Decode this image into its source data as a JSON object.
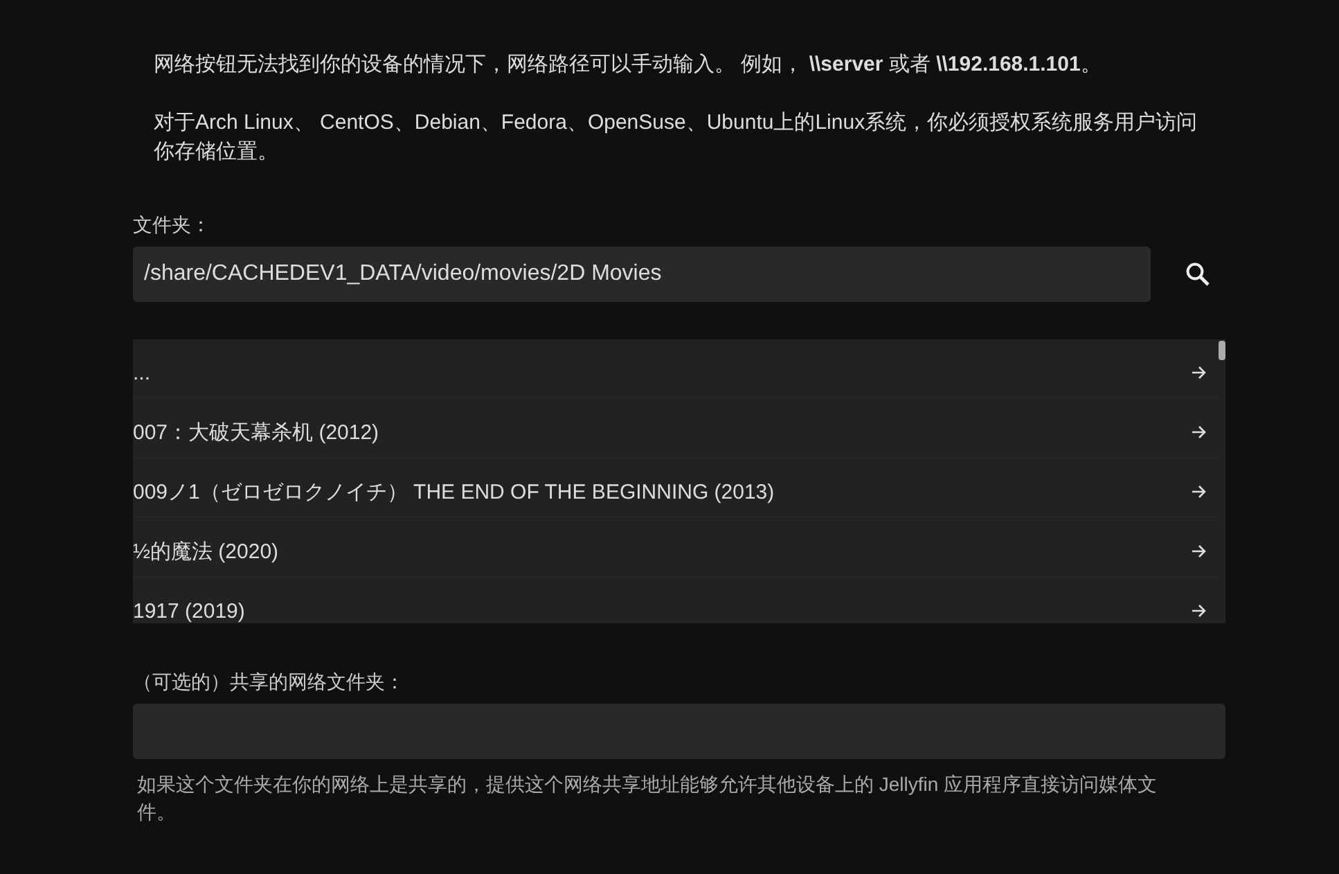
{
  "intro": [
    "网络按钮无法找到你的设备的情况下，网络路径可以手动输入。 例如， **\\\\server** 或者 **\\\\192.168.1.101**。",
    "对于Arch Linux、 CentOS、Debian、Fedora、OpenSuse、Ubuntu上的Linux系统，你必须授权系统服务用户访问你存储位置。"
  ],
  "folder": {
    "label": "文件夹：",
    "value": "/share/CACHEDEV1_DATA/video/movies/2D Movies"
  },
  "directories": [
    {
      "name": "..."
    },
    {
      "name": "007：大破天幕杀机 (2012)"
    },
    {
      "name": "009ノ1（ゼロゼロクノイチ） THE END OF THE BEGINNING (2013)"
    },
    {
      "name": "½的魔法 (2020)"
    },
    {
      "name": "1917 (2019)"
    }
  ],
  "network_share": {
    "label": "（可选的）共享的网络文件夹：",
    "help": "如果这个文件夹在你的网络上是共享的，提供这个网络共享地址能够允许其他设备上的 Jellyfin 应用程序直接访问媒体文件。"
  }
}
